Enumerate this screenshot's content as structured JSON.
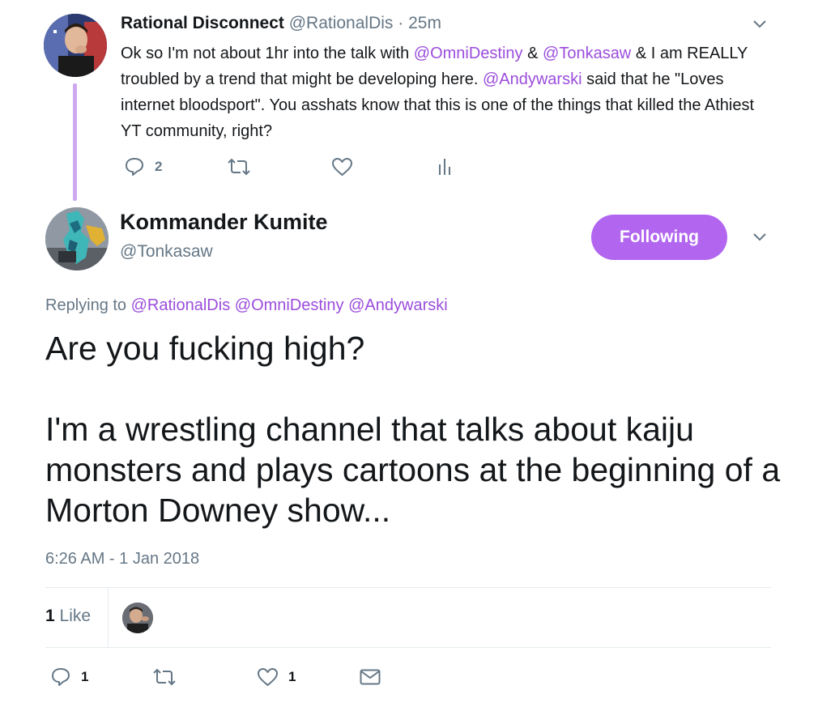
{
  "parent_tweet": {
    "display_name": "Rational Disconnect",
    "handle": "@RationalDis",
    "separator": "·",
    "time": "25m",
    "text_parts": [
      {
        "t": "Ok so I'm not about 1hr into the talk with ",
        "accent": false
      },
      {
        "t": "@OmniDestiny",
        "accent": true
      },
      {
        "t": " & ",
        "accent": false
      },
      {
        "t": "@Tonkasaw",
        "accent": true
      },
      {
        "t": " & I am REALLY troubled by a trend that might be developing here. ",
        "accent": false
      },
      {
        "t": "@Andywarski",
        "accent": true
      },
      {
        "t": " said that he \"Loves internet bloodsport\". You asshats know that this is one of the things that killed the Athiest YT community, right?",
        "accent": false
      }
    ],
    "reply_count": "2",
    "icons": [
      "reply-icon",
      "retweet-icon",
      "heart-icon",
      "analytics-icon",
      "chevron-down-icon"
    ]
  },
  "main_tweet": {
    "display_name": "Kommander Kumite",
    "handle": "@Tonkasaw",
    "follow_label": "Following",
    "replying_to_label": "Replying to",
    "replying_to": [
      "@RationalDis",
      "@OmniDestiny",
      "@Andywarski"
    ],
    "text_paragraphs": [
      "Are you fucking high?",
      "I'm a wrestling channel that talks about kaiju monsters and plays cartoons at the beginning of a Morton Downey show..."
    ],
    "timestamp": "6:26 AM - 1 Jan 2018",
    "likes_number": "1",
    "likes_label": "Like",
    "reply_count": "1",
    "like_count": "1",
    "icons": [
      "reply-icon",
      "retweet-icon",
      "heart-icon",
      "mail-icon",
      "chevron-down-icon"
    ]
  },
  "colors": {
    "accent": "#9b4ddc",
    "follow_button": "#b266f0",
    "thread_line": "#cfa9ef",
    "muted": "#657786"
  }
}
